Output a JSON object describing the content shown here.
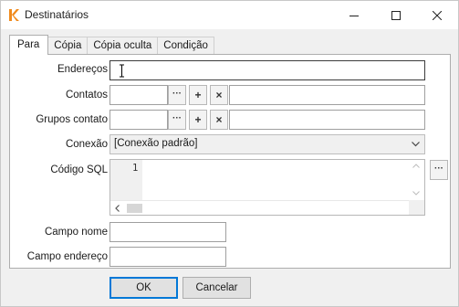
{
  "window": {
    "title": "Destinatários",
    "icon": "k-app-icon",
    "controls": [
      "minimize-icon",
      "maximize-icon",
      "close-icon"
    ]
  },
  "tabs": [
    {
      "label": "Para",
      "active": true
    },
    {
      "label": "Cópia",
      "active": false
    },
    {
      "label": "Cópia oculta",
      "active": false
    },
    {
      "label": "Condição",
      "active": false
    }
  ],
  "form": {
    "enderecos": {
      "label": "Endereços",
      "value": ""
    },
    "contatos": {
      "label": "Contatos",
      "value": "",
      "detail": ""
    },
    "grupos": {
      "label": "Grupos contato",
      "value": "",
      "detail": ""
    },
    "conexao": {
      "label": "Conexão",
      "selected": "[Conexão padrão]"
    },
    "sql": {
      "label": "Código SQL",
      "line_number": "1",
      "text": ""
    },
    "campo_nome": {
      "label": "Campo nome",
      "value": ""
    },
    "campo_endereco": {
      "label": "Campo endereço",
      "value": ""
    }
  },
  "icons": {
    "browse": "···",
    "add": "+",
    "remove": "×",
    "scroll_left": "‹",
    "scroll_right": "›",
    "scroll_up": "˄",
    "scroll_down": "˅"
  },
  "buttons": {
    "ok": "OK",
    "cancel": "Cancelar"
  },
  "colors": {
    "app_icon": "#f08a1c",
    "default_button_border": "#0078d7"
  }
}
